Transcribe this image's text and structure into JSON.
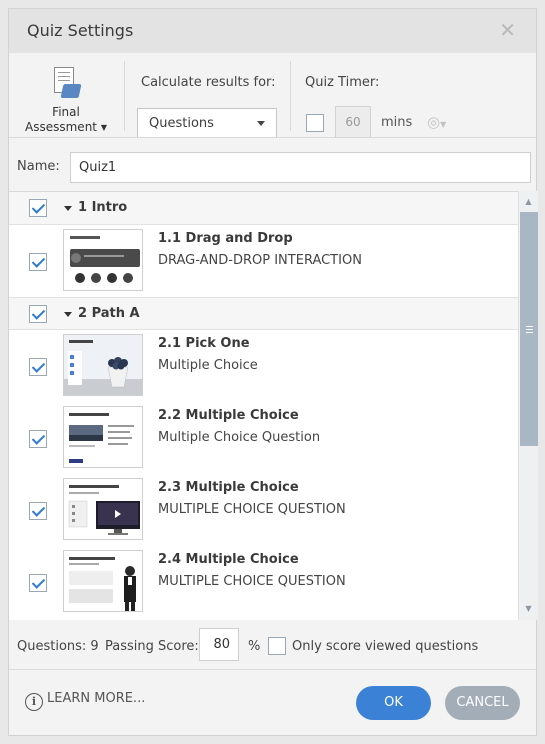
{
  "dialog": {
    "title": "Quiz Settings"
  },
  "toolbar": {
    "final_assessment_line1": "Final",
    "final_assessment_line2": "Assessment",
    "calculate_label": "Calculate results for:",
    "calculate_value": "Questions",
    "timer_label": "Quiz Timer:",
    "timer_value": "60",
    "timer_unit": "mins"
  },
  "name": {
    "label": "Name:",
    "value": "Quiz1"
  },
  "sections": [
    {
      "title": "1 Intro",
      "checked": true,
      "items": [
        {
          "title": "1.1 Drag and Drop",
          "subtitle": "DRAG-AND-DROP INTERACTION",
          "checked": true
        }
      ]
    },
    {
      "title": "2 Path A",
      "checked": true,
      "items": [
        {
          "title": "2.1 Pick One",
          "subtitle": "Multiple Choice",
          "checked": true
        },
        {
          "title": "2.2 Multiple Choice",
          "subtitle": "Multiple Choice Question",
          "checked": true
        },
        {
          "title": "2.3 Multiple Choice",
          "subtitle": "MULTIPLE CHOICE QUESTION",
          "checked": true
        },
        {
          "title": "2.4 Multiple Choice",
          "subtitle": "MULTIPLE CHOICE QUESTION",
          "checked": true
        }
      ]
    }
  ],
  "footer": {
    "questions_count": "Questions: 9",
    "passing_label": "Passing Score:",
    "passing_value": "80",
    "percent": "%",
    "only_viewed_label": "Only score viewed questions",
    "learn_more": "LEARN MORE...",
    "ok": "OK",
    "cancel": "CANCEL"
  },
  "colors": {
    "accent": "#3b82d6",
    "cancel": "#a2adb8",
    "checkbox_check": "#2e7bcf"
  }
}
